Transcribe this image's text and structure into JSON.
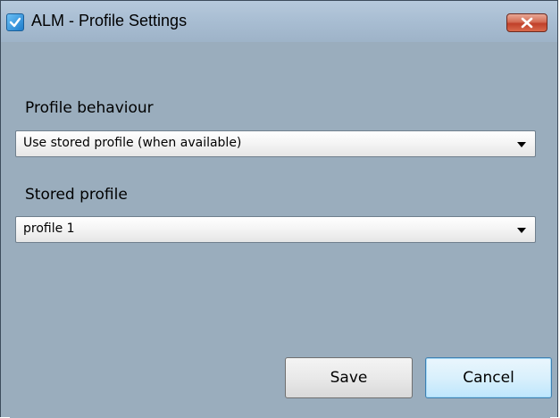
{
  "window": {
    "title": "ALM - Profile Settings",
    "app_icon": "alm-app-icon",
    "close_icon": "close-icon"
  },
  "form": {
    "profile_behaviour": {
      "label": "Profile behaviour",
      "selected": "Use stored profile (when available)"
    },
    "stored_profile": {
      "label": "Stored profile",
      "selected": "profile 1"
    }
  },
  "buttons": {
    "save_label": "Save",
    "cancel_label": "Cancel"
  },
  "colors": {
    "dialog_background": "#9aadbd",
    "close_button": "#c0402a",
    "default_button_border": "#3c7fb1"
  }
}
